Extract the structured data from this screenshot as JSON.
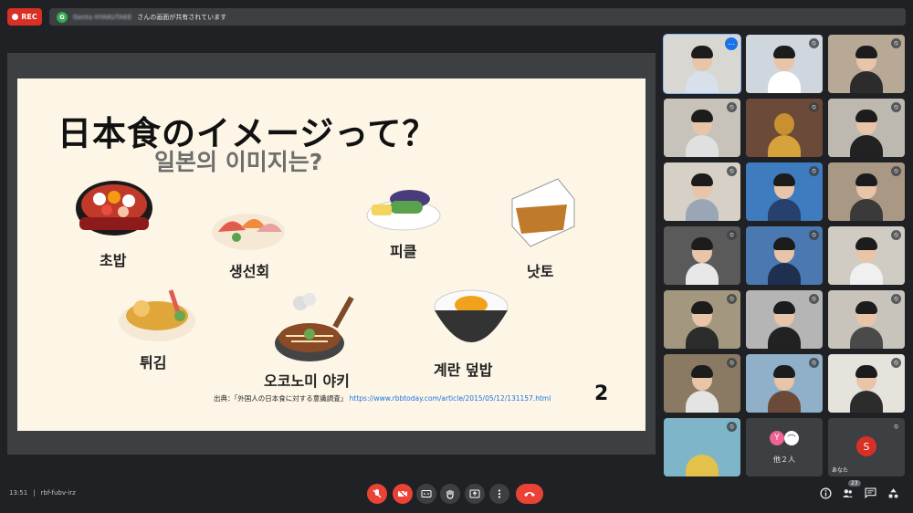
{
  "recording": {
    "label": "REC"
  },
  "share_banner": {
    "avatar": "G",
    "presenter": "Genta HYAKUTAKE",
    "text": "さんの画面が共有されています"
  },
  "slide": {
    "title_ja": "日本食のイメージって？",
    "title_ko": "일본의 이미지는?",
    "items": [
      {
        "label": "초밥",
        "icon": "sushi-icon"
      },
      {
        "label": "생선회",
        "icon": "sashimi-icon"
      },
      {
        "label": "피클",
        "icon": "pickles-icon"
      },
      {
        "label": "낫토",
        "icon": "natto-icon"
      },
      {
        "label": "튀김",
        "icon": "tempura-icon"
      },
      {
        "label": "오코노미 야키",
        "icon": "okonomiyaki-icon"
      },
      {
        "label": "계란 덮밥",
        "icon": "egg-rice-icon"
      }
    ],
    "source_label": "出典：「外国人の日本食に対する意識調査」",
    "source_link": "https://www.rbbtoday.com/article/2015/05/12/131157.html",
    "page_number": "2"
  },
  "participants": {
    "others_count_label": "他２人",
    "others_avatars": [
      "Y",
      "⌒"
    ],
    "self_initial": "S",
    "self_label": "あなた"
  },
  "footer": {
    "time": "13:51",
    "separator": "|",
    "meeting_code": "rbf-fubv-irz",
    "people_count": "23"
  },
  "colors": {
    "accent": "#1a73e8",
    "danger": "#ea4335",
    "background": "#202124"
  }
}
